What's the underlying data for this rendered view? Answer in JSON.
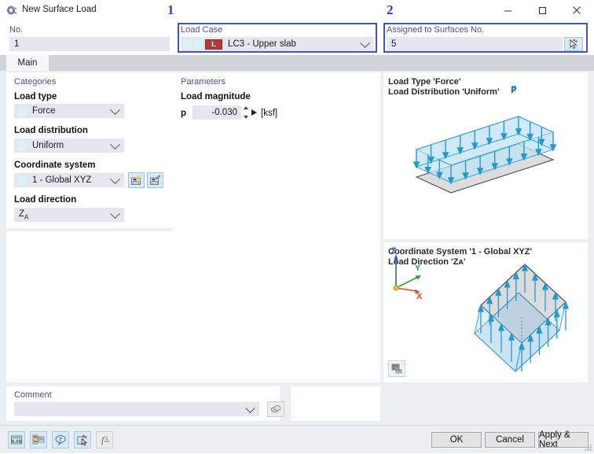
{
  "window": {
    "title": "New Surface Load",
    "app_icon": "surface-load-icon",
    "minimize": "–",
    "maximize": "☐",
    "close": "✕"
  },
  "header": {
    "no_label": "No.",
    "no_value": "1",
    "load_case_label": "Load Case",
    "load_case_badge": "L",
    "load_case_value": "LC3 - Upper slab",
    "assigned_label": "Assigned to Surfaces No.",
    "assigned_value": "5",
    "pick_button_icon": "select-surfaces-cursor-icon",
    "callout_1": "1",
    "callout_2": "2",
    "highlight_color": "#3f51d8"
  },
  "tabs": [
    {
      "label": "Main",
      "active": true
    }
  ],
  "categories": {
    "group_title": "Categories",
    "load_type_label": "Load type",
    "load_type_value": "Force",
    "load_distribution_label": "Load distribution",
    "load_distribution_value": "Uniform",
    "coordinate_system_label": "Coordinate system",
    "coordinate_system_value": "1 - Global XYZ",
    "cs_new_icon": "new-coordinate-system-icon",
    "cs_edit_icon": "edit-coordinate-system-icon",
    "load_direction_label": "Load direction",
    "load_direction_value": "Z",
    "load_direction_sub": "A"
  },
  "parameters": {
    "group_title": "Parameters",
    "magnitude_label": "Load magnitude",
    "symbol": "p",
    "value": "-0.030",
    "unit": "[ksf]",
    "spinner_icon": "stepper-updown-icon",
    "formula_icon": "apply-arrow-icon"
  },
  "preview_top": {
    "line1": "Load Type 'Force'",
    "line2": "Load Distribution 'Uniform'",
    "load_symbol": "p"
  },
  "preview_bottom": {
    "line1": "Coordinate System '1 - Global XYZ'",
    "line2": "Load Direction 'Zᴀ'",
    "axis_z": "Z",
    "axis_y": "Y",
    "axis_x": "X",
    "axis_x_color": "#d4502a",
    "axis_y_color": "#27a030",
    "axis_z_color": "#2a5fd6",
    "render_icon": "render-settings-icon"
  },
  "comment": {
    "label": "Comment",
    "value": "",
    "placeholder": "",
    "browse_icon": "comment-library-icon"
  },
  "footer": {
    "toolbar": [
      {
        "icon": "numeric-display-icon",
        "enabled": true
      },
      {
        "icon": "colors-legend-icon",
        "enabled": true
      },
      {
        "icon": "info-bubble-icon",
        "enabled": true
      },
      {
        "icon": "select-object-icon",
        "enabled": true
      },
      {
        "icon": "formula-icon",
        "enabled": false
      }
    ],
    "ok_label": "OK",
    "cancel_label": "Cancel",
    "apply_next_label": "Apply & Next"
  },
  "colors": {
    "load_arrow": "#1f9ad6",
    "load_fill": "#bfe4f2",
    "slab_fill": "#d9d9d9",
    "field_bg": "#e6e6f0",
    "group_label": "#4a4f8c",
    "accent_button": "#d6eaf8"
  }
}
